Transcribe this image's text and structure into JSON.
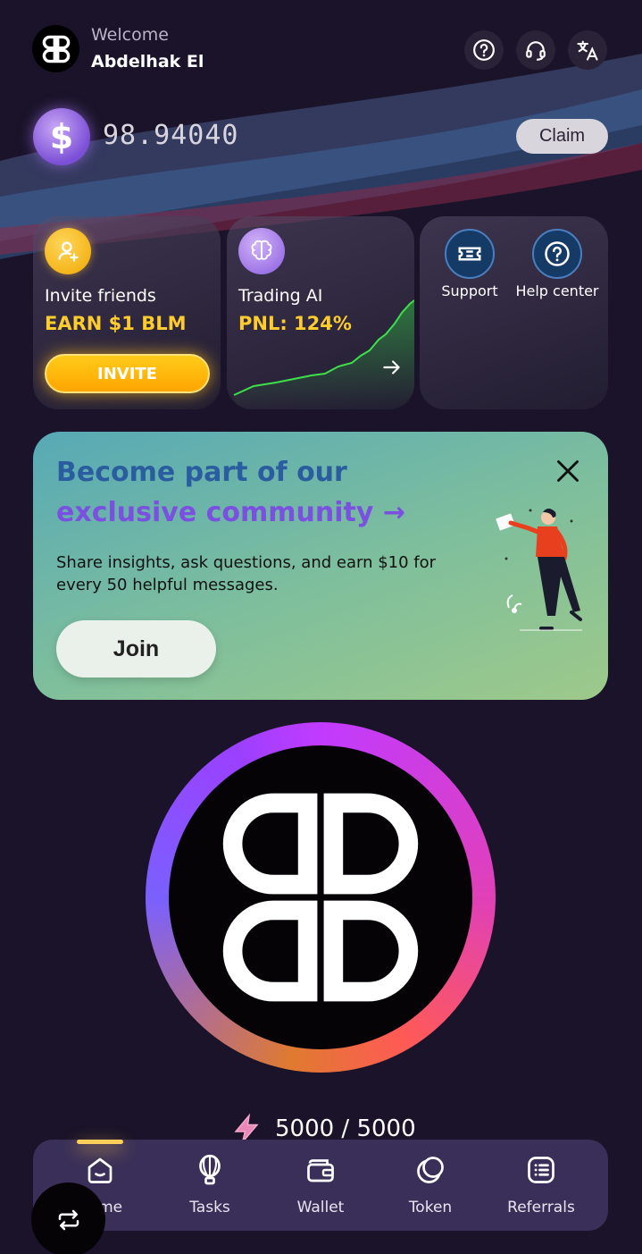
{
  "header": {
    "welcome": "Welcome",
    "username": "Abdelhak El",
    "icons": [
      "help-icon",
      "headset-icon",
      "translate-icon"
    ]
  },
  "balance": {
    "value": "98.94040",
    "claim_label": "Claim",
    "currency_symbol": "$"
  },
  "cards": {
    "invite": {
      "title": "Invite friends",
      "earn": "EARN $1 BLM",
      "button": "INVITE"
    },
    "trading": {
      "title": "Trading AI",
      "pnl": "PNL: 124%"
    },
    "services": {
      "support": "Support",
      "help": "Help center"
    }
  },
  "banner": {
    "line1": "Become part of our",
    "line2": "exclusive community →",
    "body": "Share insights, ask questions, and earn $10 for every 50 helpful messages.",
    "join": "Join"
  },
  "energy": {
    "text": "5000 / 5000"
  },
  "nav": {
    "items": [
      {
        "label": "Home",
        "icon": "home-icon",
        "active": true
      },
      {
        "label": "Tasks",
        "icon": "balloon-icon",
        "active": false
      },
      {
        "label": "Wallet",
        "icon": "wallet-icon",
        "active": false
      },
      {
        "label": "Token",
        "icon": "token-icon",
        "active": false
      },
      {
        "label": "Referrals",
        "icon": "list-icon",
        "active": false
      }
    ]
  },
  "colors": {
    "background": "#1a1329",
    "accent_yellow": "#ffcc2e",
    "nav_bg": "#3a2f58",
    "banner_title_blue": "#2a5d9f",
    "banner_title_purple": "#7b4fe0"
  }
}
